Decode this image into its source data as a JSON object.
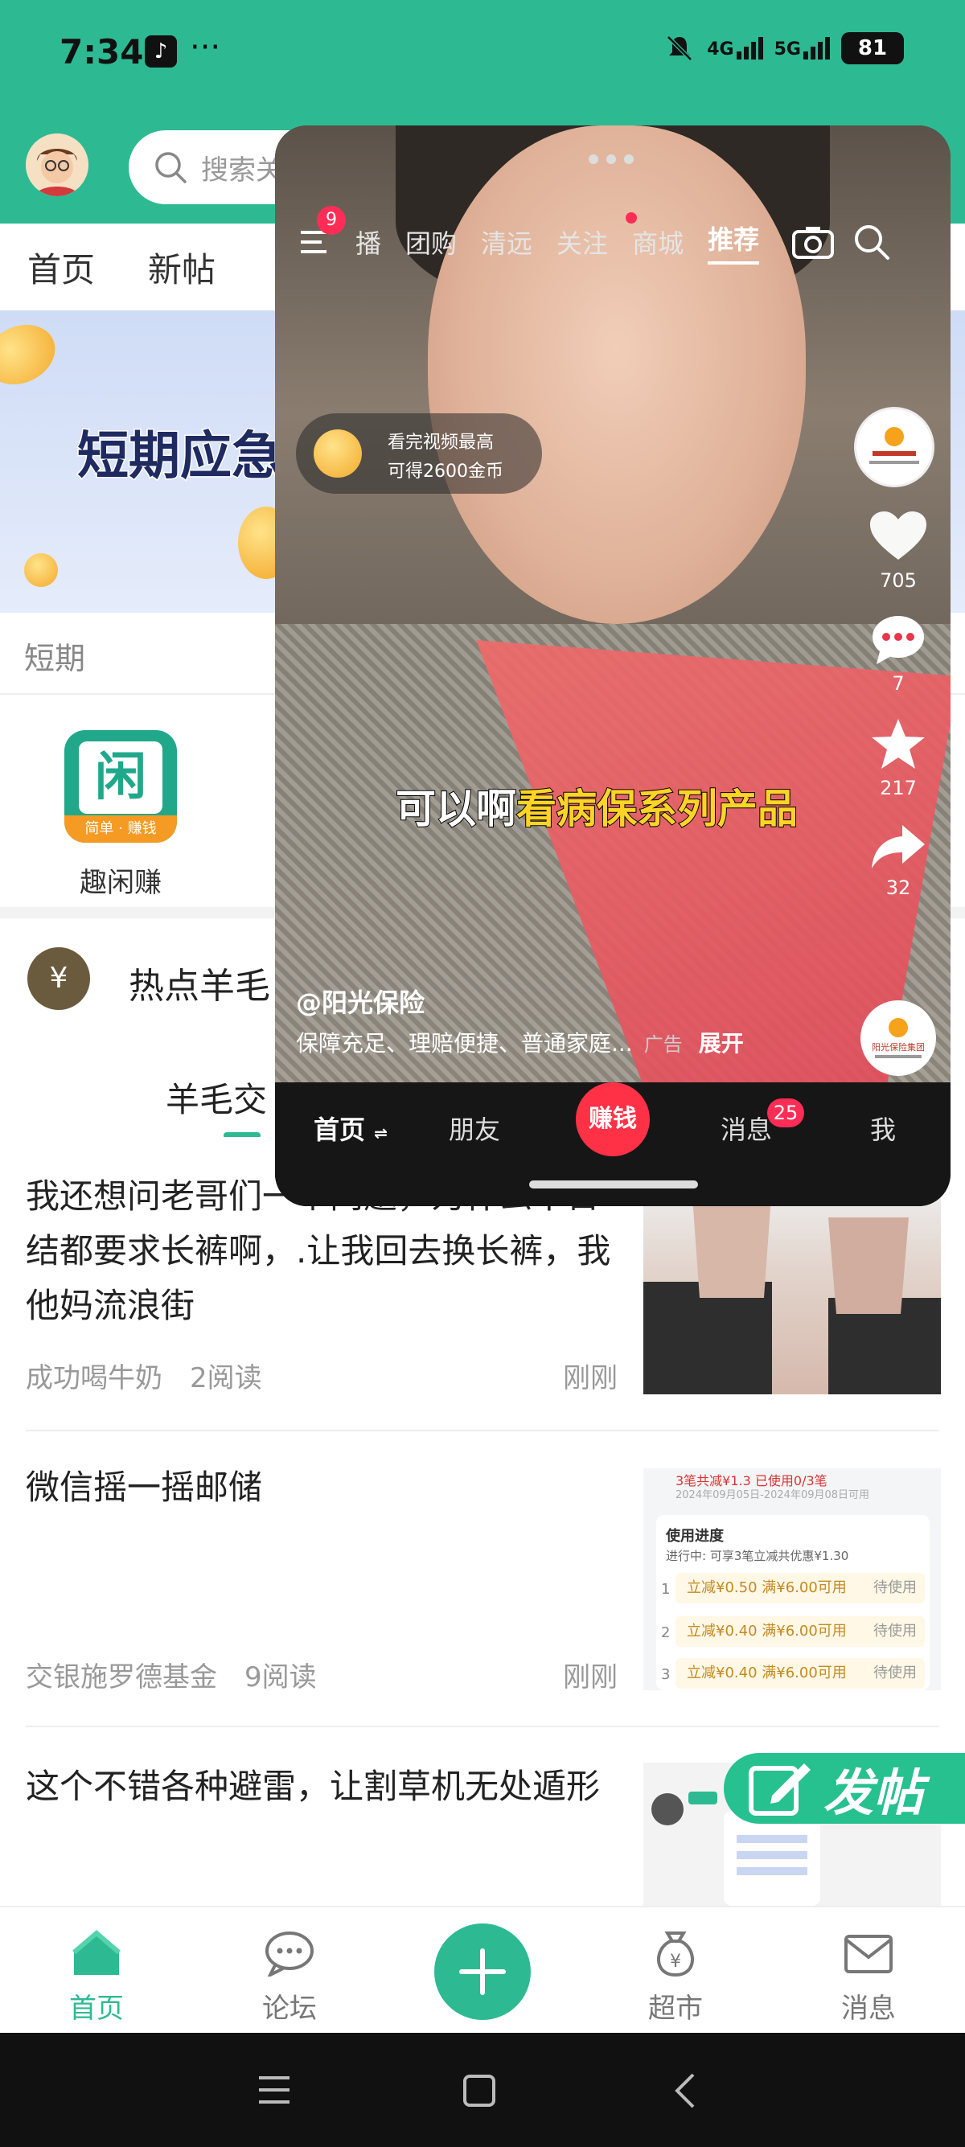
{
  "status_bar": {
    "time": "7:34",
    "signal_4g": "4G",
    "signal_5g": "5G",
    "battery": "81"
  },
  "header": {
    "search_placeholder": "搜索关",
    "tabs": [
      "首页",
      "新帖"
    ]
  },
  "banner": {
    "text": "短期应急"
  },
  "section": {
    "label": "短期"
  },
  "apps": [
    {
      "name": "趣闲赚",
      "icon_char": "闲",
      "icon_footer": "简单 · 赚钱"
    }
  ],
  "hot": {
    "title": "热点羊毛"
  },
  "sub_tabs": {
    "active": "羊毛交"
  },
  "feed": [
    {
      "title": "我还想问老哥们一个问题，为什么干日结都要求长裤啊，.让我回去换长裤，我他妈流浪街",
      "author": "成功喝牛奶",
      "reads": "2阅读",
      "time": "刚刚"
    },
    {
      "title": "微信摇一摇邮储",
      "author": "交银施罗德基金",
      "reads": "9阅读",
      "time": "刚刚",
      "thumb": {
        "top_amount": "3笔共减¥1.3 已使用0/3笔",
        "top_date": "2024年09月05日-2024年09月08日可用",
        "heading": "使用进度",
        "sub": "进行中: 可享3笔立减共优惠¥1.30",
        "rows": [
          {
            "num": "1",
            "text": "立减¥0.50 满¥6.00可用",
            "status": "待使用"
          },
          {
            "num": "2",
            "text": "立减¥0.40 满¥6.00可用",
            "status": "待使用"
          },
          {
            "num": "3",
            "text": "立减¥0.40 满¥6.00可用",
            "status": "待使用"
          }
        ]
      }
    },
    {
      "title": "这个不错各种避雷，让割草机无处遁形",
      "author": "",
      "reads": "",
      "time": ""
    }
  ],
  "fab": {
    "label": "发帖"
  },
  "bottom_nav": [
    {
      "label": "首页",
      "icon": "home-icon",
      "active": true
    },
    {
      "label": "论坛",
      "icon": "forum-icon",
      "active": false
    },
    {
      "label": "",
      "icon": "plus-icon",
      "active": false
    },
    {
      "label": "超市",
      "icon": "moneybag-icon",
      "active": false
    },
    {
      "label": "消息",
      "icon": "mail-icon",
      "active": false
    }
  ],
  "video_app": {
    "menu_badge": "9",
    "tabs": [
      "播",
      "团购",
      "清远",
      "关注",
      "商城",
      "推荐"
    ],
    "active_tab": "推荐",
    "reward_line1": "看完视频最高",
    "reward_line2": "可得2600金币",
    "likes": "705",
    "comments": "7",
    "favorites": "217",
    "shares": "32",
    "subtitle_a": "可以啊",
    "subtitle_b": "看病保系列产品",
    "author": "@阳光保险",
    "description": "保障充足、理赔便捷、普通家庭...",
    "ad_tag": "广告",
    "expand": "展开",
    "nav": {
      "home": "首页",
      "friends": "朋友",
      "earn": "赚钱",
      "messages": "消息",
      "messages_badge": "25",
      "me": "我"
    },
    "logo_text": "阳光保险集团"
  },
  "colors": {
    "brand_green": "#2dba93",
    "badge_red": "#ff2d55",
    "earn_red": "#ff3146",
    "subtitle_yellow": "#ffd426"
  }
}
